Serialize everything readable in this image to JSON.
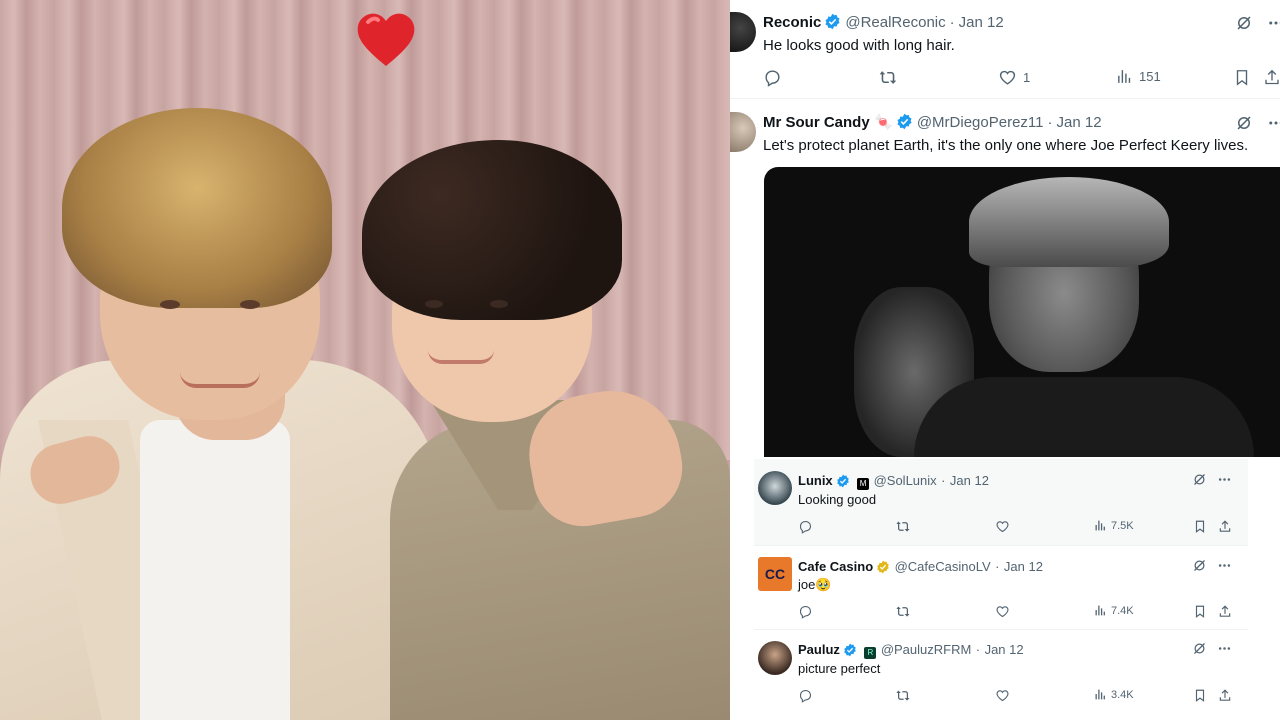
{
  "feed": {
    "tweets": [
      {
        "display_name": "Reconic",
        "handle": "@RealReconic",
        "separator": "·",
        "date": "Jan 12",
        "text": "He looks good with long hair.",
        "replies": "",
        "retweets": "",
        "likes": "1",
        "views": "151"
      },
      {
        "display_name": "Mr Sour Candy",
        "name_emoji": "🍬",
        "handle": "@MrDiegoPerez11",
        "separator": "·",
        "date": "Jan 12",
        "text": "Let's protect planet Earth, it's the only one where Joe Perfect Keery lives."
      }
    ],
    "replies": [
      {
        "display_name": "Lunix",
        "affiliate_badge": "M",
        "handle": "@SolLunix",
        "separator": "·",
        "date": "Jan 12",
        "text": "Looking good",
        "views": "7.5K"
      },
      {
        "display_name": "Cafe Casino",
        "handle": "@CafeCasinoLV",
        "separator": "·",
        "date": "Jan 12",
        "text": "joe🥹",
        "views": "7.4K",
        "avatar_text": "CC"
      },
      {
        "display_name": "Pauluz",
        "affiliate_badge": "R",
        "handle": "@PauluzRFRM",
        "separator": "·",
        "date": "Jan 12",
        "text": "picture perfect",
        "views": "3.4K"
      }
    ]
  },
  "colors": {
    "verified_blue": "#1d9bf0",
    "verified_gold": "#e2b719",
    "muted": "#536471",
    "heart": "#e0242b"
  },
  "icons": [
    "heart-emoji",
    "verified-icon",
    "grok-icon",
    "more-icon",
    "reply-icon",
    "retweet-icon",
    "like-icon",
    "views-icon",
    "bookmark-icon",
    "share-icon"
  ]
}
